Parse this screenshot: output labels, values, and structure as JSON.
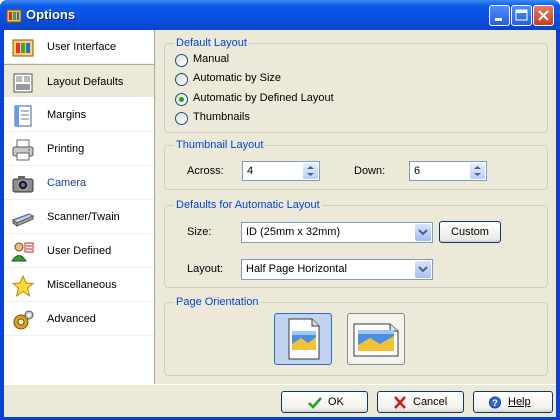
{
  "window": {
    "title": "Options"
  },
  "sidebar": {
    "items": [
      {
        "label": "User Interface",
        "icon": "user-interface-icon"
      },
      {
        "label": "Layout Defaults",
        "icon": "layout-defaults-icon",
        "selected": true
      },
      {
        "label": "Margins",
        "icon": "margins-icon"
      },
      {
        "label": "Printing",
        "icon": "printer-icon"
      },
      {
        "label": "Camera",
        "icon": "camera-icon"
      },
      {
        "label": "Scanner/Twain",
        "icon": "scanner-icon"
      },
      {
        "label": "User Defined",
        "icon": "user-defined-icon"
      },
      {
        "label": "Miscellaneous",
        "icon": "star-icon"
      },
      {
        "label": "Advanced",
        "icon": "advanced-icon"
      }
    ]
  },
  "default_layout": {
    "title": "Default Layout",
    "options": [
      {
        "label": "Manual",
        "checked": false
      },
      {
        "label": "Automatic by Size",
        "checked": false
      },
      {
        "label": "Automatic by Defined Layout",
        "checked": true
      },
      {
        "label": "Thumbnails",
        "checked": false
      }
    ]
  },
  "thumbnail_layout": {
    "title": "Thumbnail Layout",
    "across_label": "Across:",
    "across_value": "4",
    "down_label": "Down:",
    "down_value": "6"
  },
  "automatic_layout": {
    "title": "Defaults for Automatic Layout",
    "size_label": "Size:",
    "size_value": "ID (25mm x 32mm)",
    "custom_label": "Custom",
    "layout_label": "Layout:",
    "layout_value": "Half Page Horizontal"
  },
  "page_orientation": {
    "title": "Page Orientation",
    "selected": "portrait"
  },
  "buttons": {
    "ok": "OK",
    "cancel": "Cancel",
    "help": "Help"
  },
  "colors": {
    "title_bar": "#0a4fe0",
    "group_title": "#0046d5",
    "face": "#ece9d8",
    "radio_dot": "#21a121"
  }
}
